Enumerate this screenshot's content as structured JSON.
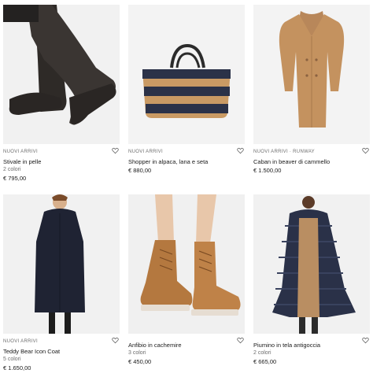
{
  "products": [
    {
      "tag": "NUOVI ARRIVI",
      "name": "Stivale in pelle",
      "colors": "2 colori",
      "price": "€ 795,00",
      "image": "knee-high black leather boot"
    },
    {
      "tag": "NUOVI ARRIVI",
      "name": "Shopper in alpaca, lana e seta",
      "colors": "",
      "price": "€ 880,00",
      "image": "striped camel and navy tote bag"
    },
    {
      "tag": "NUOVI ARRIVI · RUNWAY",
      "name": "Caban in beaver di cammello",
      "colors": "",
      "price": "€ 1.500,00",
      "image": "camel double-breasted coat"
    },
    {
      "tag": "NUOVI ARRIVI",
      "name": "Teddy Bear Icon Coat",
      "colors": "5 colori",
      "price": "€ 1.650,00",
      "image": "model in navy teddy coat"
    },
    {
      "tag": "",
      "name": "Anfibio in cachemire",
      "colors": "3 colori",
      "price": "€ 450,00",
      "image": "tan lace-up ankle boots"
    },
    {
      "tag": "",
      "name": "Piumino in tela antigoccia",
      "colors": "2 colori",
      "price": "€ 665,00",
      "image": "model in long navy puffer coat"
    }
  ],
  "icons": {
    "wishlist": "heart-icon"
  },
  "palette": {
    "background": "#ffffff",
    "image_bg": "#f2f2f2",
    "muted_text": "#6e6e6e",
    "text": "#1a1a1a"
  }
}
